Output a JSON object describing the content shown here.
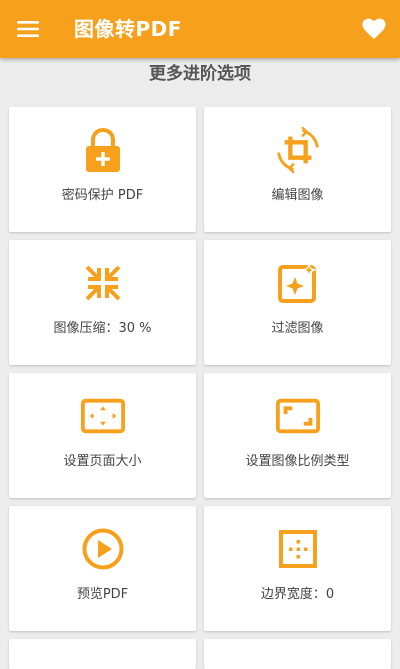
{
  "app": {
    "title": "图像转PDF",
    "accent_color": "#f7a01b",
    "header_icons": {
      "left": "menu-icon",
      "right": "heart-icon"
    }
  },
  "section": {
    "title": "更多进阶选项"
  },
  "options": [
    {
      "label": "密码保护 PDF",
      "icon": "lock-plus-icon"
    },
    {
      "label": "编辑图像",
      "icon": "crop-rotate-icon"
    },
    {
      "label": "图像压缩：30 %",
      "icon": "compress-arrows-icon"
    },
    {
      "label": "过滤图像",
      "icon": "image-filter-icon"
    },
    {
      "label": "设置页面大小",
      "icon": "page-size-icon"
    },
    {
      "label": "设置图像比例类型",
      "icon": "aspect-ratio-icon"
    },
    {
      "label": "预览PDF",
      "icon": "play-circle-icon"
    },
    {
      "label": "边界宽度：0",
      "icon": "border-width-icon"
    }
  ]
}
